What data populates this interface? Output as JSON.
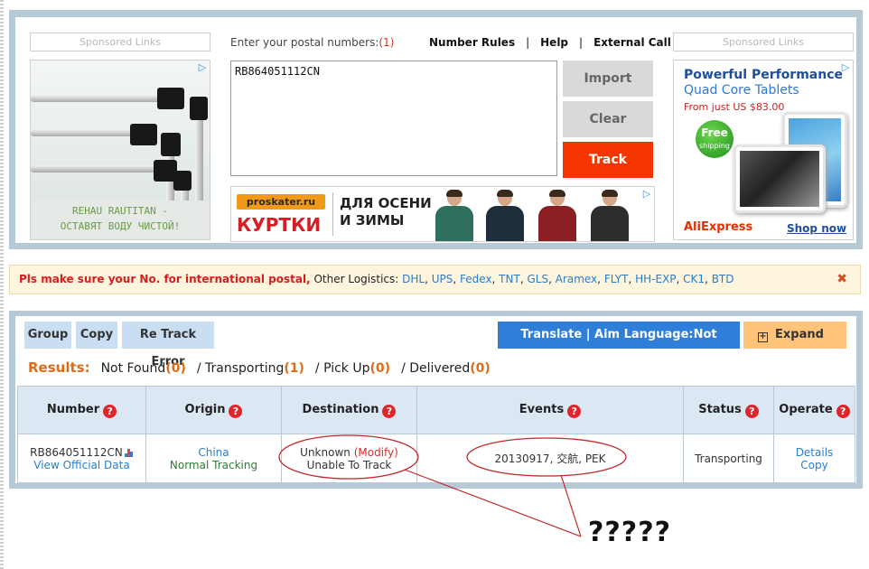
{
  "sponsored": {
    "left": "Sponsored Links",
    "right": "Sponsored Links"
  },
  "ad_left": {
    "caption_line1": "REHAU RAUTITAN -",
    "caption_line2": "ОСТАВЯТ ВОДУ ЧИСТОЙ!",
    "adchoice": "▷"
  },
  "postal": {
    "label": "Enter your postal numbers:",
    "count": "(1)",
    "value": "RB864051112CN"
  },
  "toplinks": {
    "number_rules": "Number Rules",
    "help": "Help",
    "external_call": "External Call",
    "sep": "|"
  },
  "buttons": {
    "import": "Import",
    "clear": "Clear",
    "track": "Track"
  },
  "ad_mid": {
    "brand": "proskater.ru",
    "headline": "КУРТКИ",
    "tagline": "ДЛЯ ОСЕНИ И ЗИМЫ",
    "adchoice": "▷"
  },
  "ad_right": {
    "h1": "Powerful Performance",
    "h2": "Quad Core Tablets",
    "h3": "From just US $83.00",
    "free1": "Free",
    "free2": "shipping",
    "brand": "AliExpress",
    "shop": "Shop now ▸",
    "adchoice": "▷"
  },
  "notice": {
    "warning": "Pls make sure your No. for international postal,",
    "other_label": "Other Logistics:",
    "links": [
      "DHL",
      "UPS",
      "Fedex",
      "TNT",
      "GLS",
      "Aramex",
      "FLYT",
      "HH-EXP",
      "CK1",
      "BTD"
    ],
    "close": "✖"
  },
  "results": {
    "buttons": {
      "group": "Group",
      "copy": "Copy",
      "retrack": "Re Track Error"
    },
    "translate": "Translate | Aim Language:Not Translated",
    "expand": "Expand",
    "summary": {
      "label": "Results:",
      "not_found_label": "Not Found",
      "not_found": "(0)",
      "transporting_label": "/ Transporting",
      "transporting": "(1)",
      "pickup_label": "/ Pick Up",
      "pickup": "(0)",
      "delivered_label": "/ Delivered",
      "delivered": "(0)"
    },
    "columns": [
      "Number",
      "Origin",
      "Destination",
      "Events",
      "Status",
      "Operate"
    ],
    "help_glyph": "?",
    "row": {
      "number": "RB864051112CN",
      "official": "View Official Data",
      "origin": "China",
      "origin_sub": "Normal Tracking",
      "destination": "Unknown",
      "modify": "(Modify)",
      "destination_sub": "Unable To Track",
      "event": "20130917, 交航, PEK",
      "status": "Transporting",
      "details": "Details",
      "copy": "Copy"
    }
  },
  "annotation": {
    "text": "?????"
  },
  "colors": {
    "panel_border": "#b8c9d6",
    "track_button": "#f43500",
    "translate_button": "#2f7ed8",
    "expand_button": "#ffc37a",
    "notice_bg": "#fdf5dd",
    "link": "#2a7dc9",
    "accent_orange": "#e06b17",
    "annotation_red": "#c0282d"
  }
}
